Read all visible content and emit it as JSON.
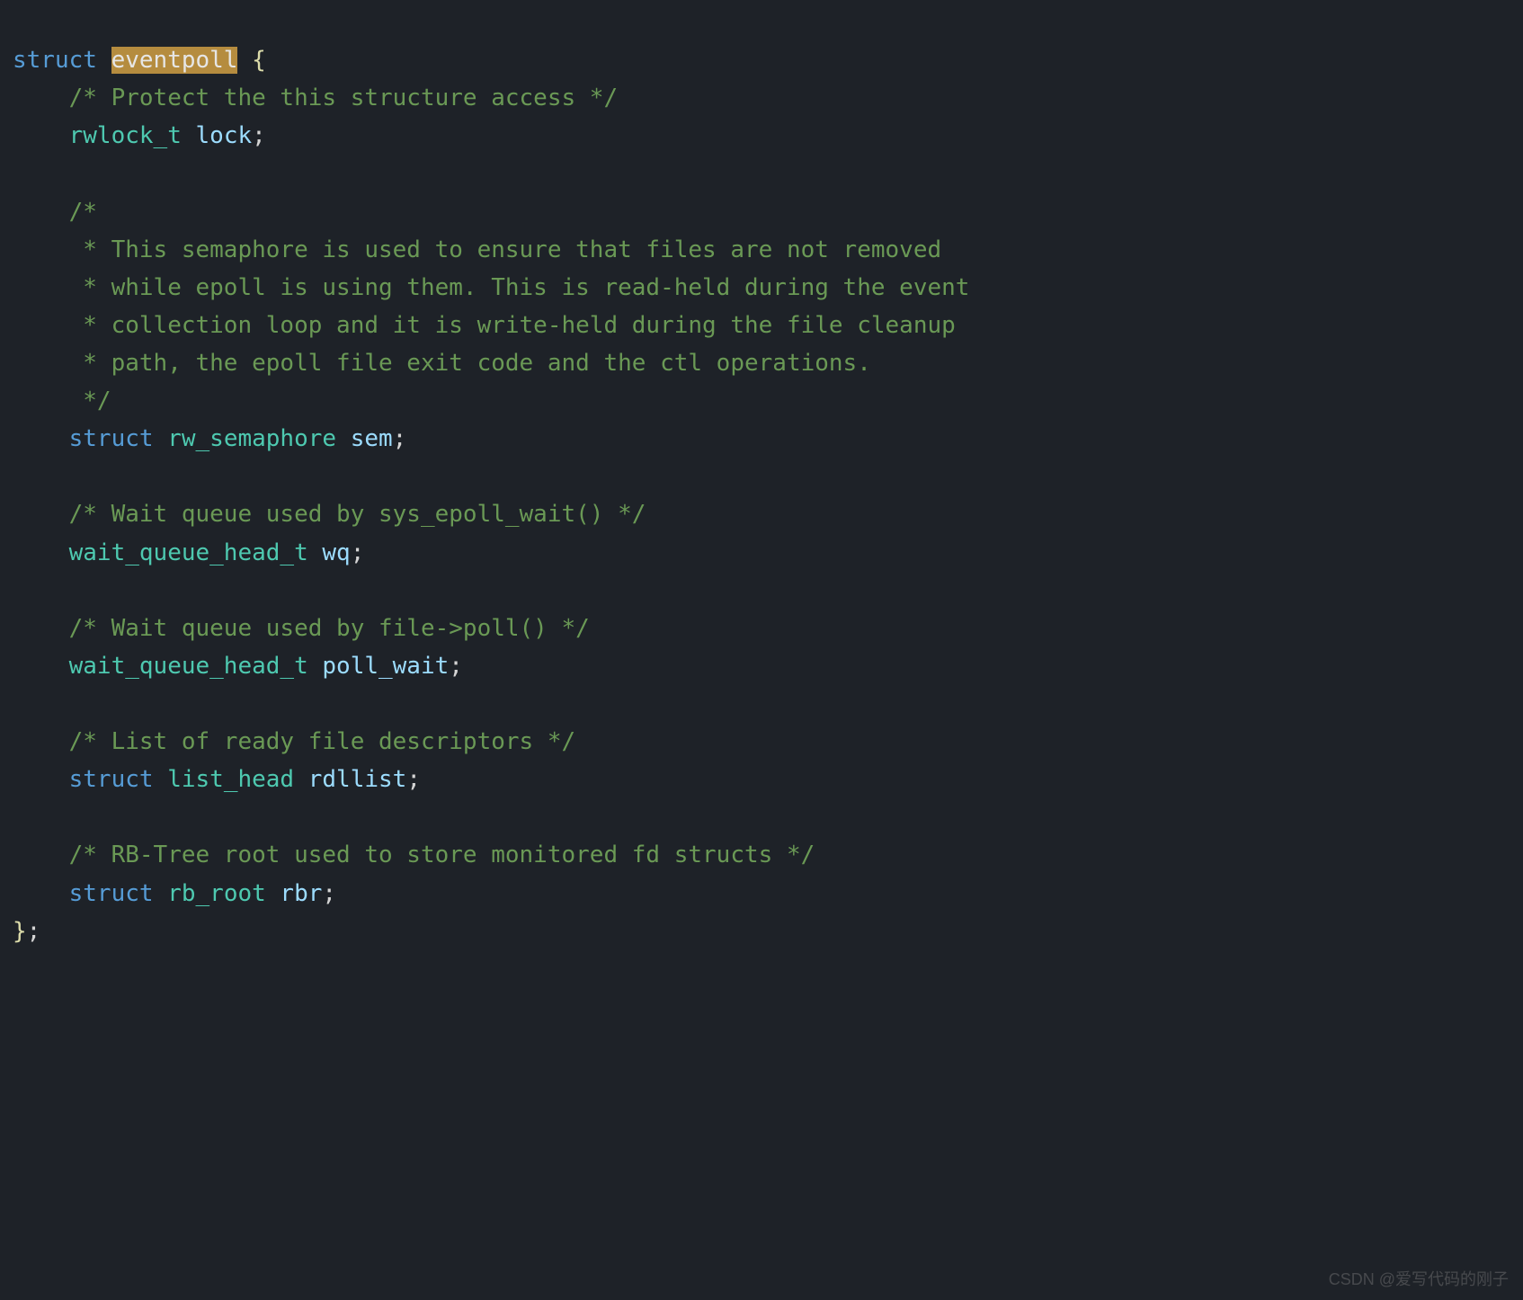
{
  "code": {
    "line1": {
      "keyword": "struct",
      "highlight": "eventpoll",
      "brace": " {"
    },
    "comment1": "/* Protect the this structure access */",
    "line_lock": {
      "type": "rwlock_t",
      "identifier": " lock",
      "end": ";"
    },
    "comment2_open": "/*",
    "comment2_l1": " * This semaphore is used to ensure that files are not removed",
    "comment2_l2": " * while epoll is using them. This is read-held during the event",
    "comment2_l3": " * collection loop and it is write-held during the file cleanup",
    "comment2_l4": " * path, the epoll file exit code and the ctl operations.",
    "comment2_close": " */",
    "line_sem": {
      "keyword": "struct",
      "type": " rw_semaphore",
      "identifier": " sem",
      "end": ";"
    },
    "comment3": "/* Wait queue used by sys_epoll_wait() */",
    "line_wq": {
      "type": "wait_queue_head_t",
      "identifier": " wq",
      "end": ";"
    },
    "comment4": "/* Wait queue used by file->poll() */",
    "line_pollwait": {
      "type": "wait_queue_head_t",
      "identifier": " poll_wait",
      "end": ";"
    },
    "comment5": "/* List of ready file descriptors */",
    "line_rdllist": {
      "keyword": "struct",
      "type": " list_head",
      "identifier": " rdllist",
      "end": ";"
    },
    "comment6": "/* RB-Tree root used to store monitored fd structs */",
    "line_rbr": {
      "keyword": "struct",
      "type": " rb_root",
      "identifier": " rbr",
      "end": ";"
    },
    "closing_brace": "}",
    "closing_semicolon": ";"
  },
  "watermark": "CSDN @爱写代码的刚子"
}
